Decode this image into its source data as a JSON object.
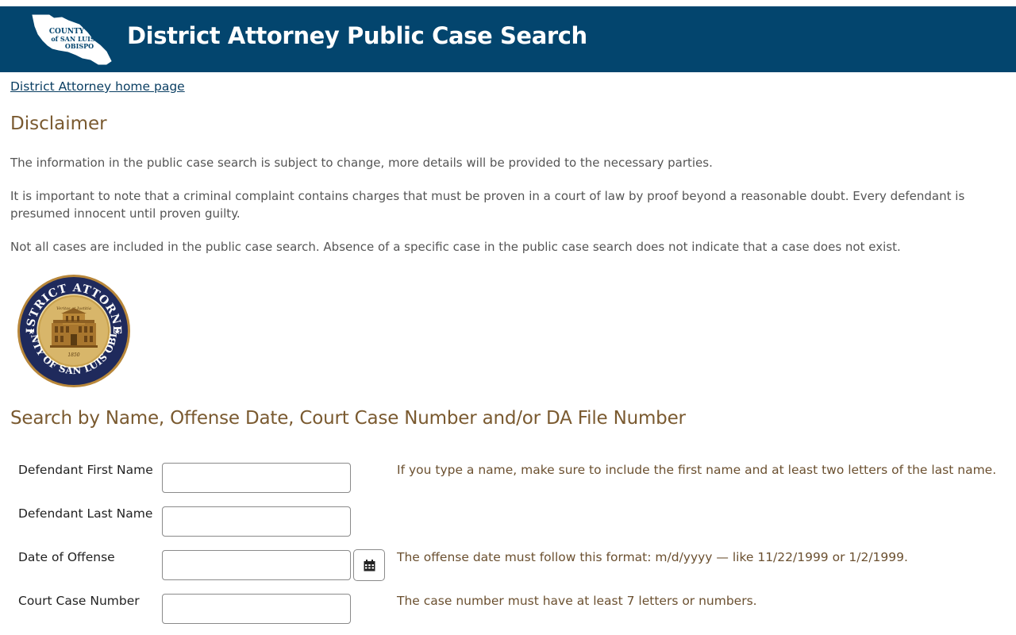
{
  "header": {
    "title": "District Attorney Public Case Search",
    "logo_text": [
      "COUNTY",
      "of SAN LUIS",
      "OBISPO"
    ]
  },
  "nav": {
    "home_link": "District Attorney home page"
  },
  "disclaimer": {
    "heading": "Disclaimer",
    "paragraphs": [
      "The information in the public case search is subject to change, more details will be provided to the necessary parties.",
      "It is important to note that a criminal complaint contains charges that must be proven in a court of law by proof beyond a reasonable doubt. Every defendant is presumed innocent until proven guilty.",
      "Not all cases are included in the public case search. Absence of a specific case in the public case search does not indicate that a case does not exist."
    ]
  },
  "seal": {
    "top_text": "DISTRICT ATTORNEY",
    "bottom_text": "COUNTY OF SAN LUIS OBISPO",
    "motto": "Veritas et Justitia",
    "year": "1850"
  },
  "search": {
    "heading": "Search by Name, Offense Date, Court Case Number and/or DA File Number",
    "fields": [
      {
        "label": "Defendant First Name",
        "value": "",
        "hint": "If you type a name, make sure to include the first name and at least two letters of the last name."
      },
      {
        "label": "Defendant Last Name",
        "value": "",
        "hint": ""
      },
      {
        "label": "Date of Offense",
        "value": "",
        "hint": "The offense date must follow this format: m/d/yyyy — like 11/22/1999 or 1/2/1999."
      },
      {
        "label": "Court Case Number",
        "value": "",
        "hint": "The case number must have at least 7 letters or numbers."
      }
    ],
    "calendar_icon": "calendar-icon"
  },
  "colors": {
    "header_bg": "#03456e",
    "heading": "#7a5a30",
    "link": "#0b3f63",
    "seal_ring": "#1f2a5c",
    "seal_gold": "#b8873a"
  }
}
